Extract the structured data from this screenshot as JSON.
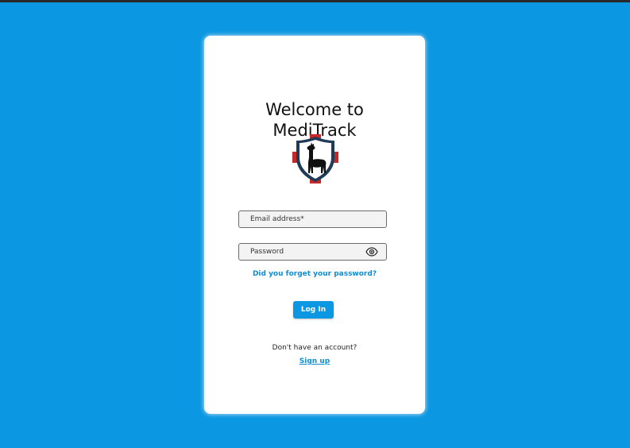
{
  "app": {
    "title_line1": "Welcome to",
    "title_line2": "MediTrack"
  },
  "logo": {
    "icon": "llama-shield-logo",
    "colors": {
      "cross": "#c62828",
      "shield": "#1f3b57",
      "llama": "#111111"
    }
  },
  "form": {
    "email_placeholder": "Email address*",
    "password_placeholder": "Password",
    "show_password_icon": "eye-icon",
    "forgot_password_label": "Did you forget your password?",
    "login_label": "Log In"
  },
  "footer": {
    "no_account_text": "Don't have an account?",
    "signup_label": "Sign up"
  },
  "colors": {
    "background": "#0b97e1",
    "accent": "#0b97e1",
    "link": "#0b8ed6"
  }
}
